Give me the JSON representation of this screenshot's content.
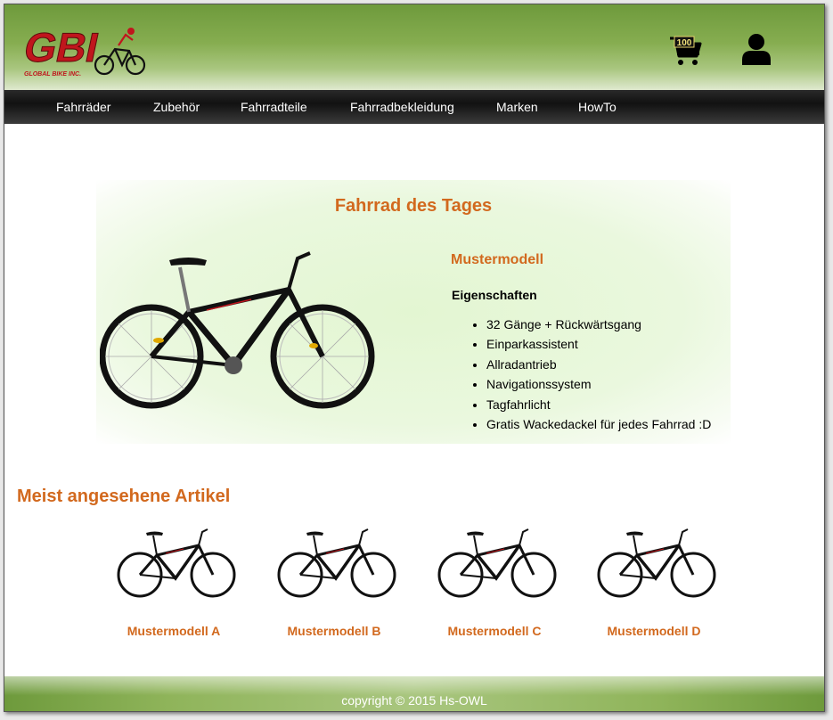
{
  "header": {
    "logo_text": "GBI",
    "logo_subtitle": "GLOBAL BIKE INC.",
    "cart_count": "100",
    "cart_icon": "shopping-cart-icon",
    "user_icon": "user-icon",
    "accent_color": "#d2691e",
    "brand_green": "#86ad50"
  },
  "nav": {
    "items": [
      {
        "label": "Fahrräder"
      },
      {
        "label": "Zubehör"
      },
      {
        "label": "Fahrradteile"
      },
      {
        "label": "Fahrradbekleidung"
      },
      {
        "label": "Marken"
      },
      {
        "label": "HowTo"
      }
    ]
  },
  "featured": {
    "title": "Fahrrad des Tages",
    "model": "Mustermodell",
    "properties_title": "Eigenschaften",
    "properties": [
      "32 Gänge + Rückwärtsgang",
      "Einparkassistent",
      "Allradantrieb",
      "Navigationssystem",
      "Tagfahrlicht",
      "Gratis Wackedackel für jedes Fahrrad :D"
    ]
  },
  "most_viewed": {
    "title": "Meist angesehene Artikel",
    "items": [
      {
        "name": "Mustermodell A"
      },
      {
        "name": "Mustermodell B"
      },
      {
        "name": "Mustermodell C"
      },
      {
        "name": "Mustermodell D"
      }
    ]
  },
  "footer": {
    "copyright": "copyright © 2015 Hs-OWL"
  }
}
